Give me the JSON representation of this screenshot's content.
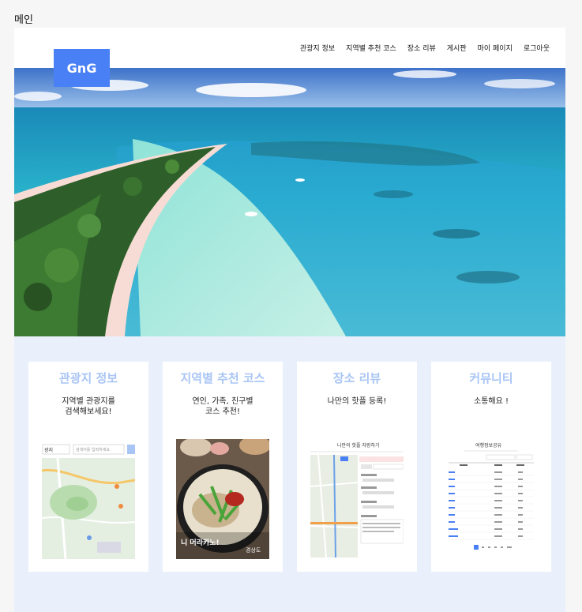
{
  "page": {
    "title": "메인"
  },
  "header": {
    "logo": "GnG",
    "nav": [
      "관광지 정보",
      "지역별 추천 코스",
      "장소 리뷰",
      "게시판",
      "마이 페이지",
      "로그아웃"
    ]
  },
  "cards": [
    {
      "title": "관광지 정보",
      "desc": "지역별 관광지를\n검색해보세요!",
      "thumb": {
        "select": "광지",
        "search_placeholder": "검색어를 입력하세요"
      }
    },
    {
      "title": "지역별 추천 코스",
      "desc": "연인, 가족, 친구별\n코스 추천!",
      "thumb": {
        "caption_left": "니 머라카노!",
        "caption_right": "경상도"
      }
    },
    {
      "title": "장소 리뷰",
      "desc": "나만의 핫플 등록!",
      "thumb": {
        "heading": "나만의 핫플 자랑하기"
      }
    },
    {
      "title": "커뮤니티",
      "desc": "소통해요 !",
      "thumb": {
        "heading": "여행정보공유"
      }
    }
  ],
  "colors": {
    "logo_bg": "#4a80f5",
    "card_title": "#a9c5f5",
    "lower_bg": "#eaf0fb"
  }
}
